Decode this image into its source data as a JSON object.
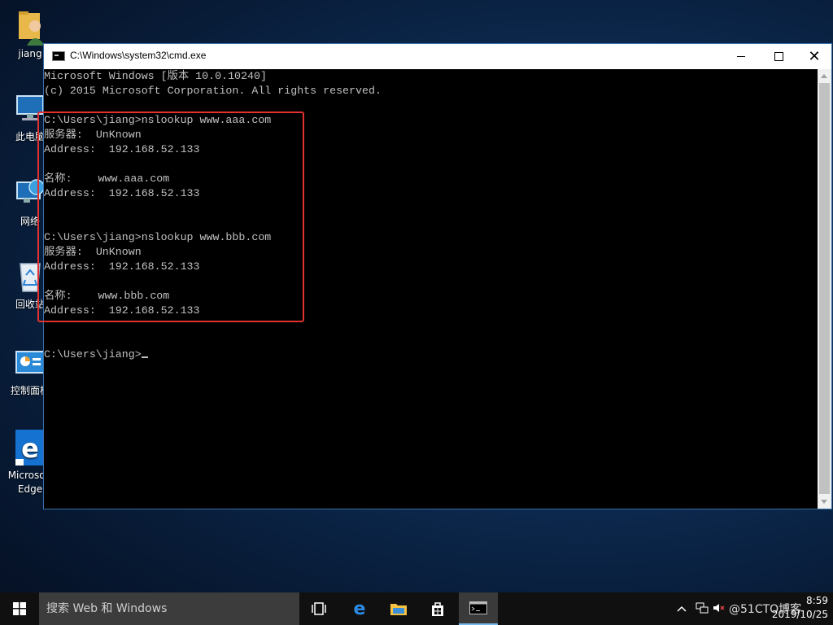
{
  "desktop": {
    "icons": [
      {
        "label": "jiang",
        "icon": "user-folder-icon"
      },
      {
        "label": "此电脑",
        "icon": "this-pc-icon"
      },
      {
        "label": "网络",
        "icon": "network-icon"
      },
      {
        "label": "回收站",
        "icon": "recycle-bin-icon"
      },
      {
        "label": "控制面板",
        "icon": "control-panel-icon"
      },
      {
        "label": "Microsoft",
        "label2": "Edge",
        "icon": "edge-icon"
      }
    ]
  },
  "window": {
    "title": "C:\\Windows\\system32\\cmd.exe",
    "controls": {
      "minimize": "minimize",
      "maximize": "maximize",
      "close": "✕"
    }
  },
  "console": {
    "lines": [
      "Microsoft Windows [版本 10.0.10240]",
      "(c) 2015 Microsoft Corporation. All rights reserved.",
      "",
      "C:\\Users\\jiang>nslookup www.aaa.com",
      "服务器:  UnKnown",
      "Address:  192.168.52.133",
      "",
      "名称:    www.aaa.com",
      "Address:  192.168.52.133",
      "",
      "",
      "C:\\Users\\jiang>nslookup www.bbb.com",
      "服务器:  UnKnown",
      "Address:  192.168.52.133",
      "",
      "名称:    www.bbb.com",
      "Address:  192.168.52.133",
      "",
      "",
      "C:\\Users\\jiang>"
    ]
  },
  "taskbar": {
    "search_placeholder": "搜索 Web 和 Windows",
    "clock_time": "8:59",
    "clock_date": "2019/10/25",
    "watermark": "@51CTO博客"
  },
  "colors": {
    "console_bg": "#000000",
    "console_fg": "#c0c0c0",
    "highlight_border": "#e2312f",
    "taskbar_bg": "#101010"
  }
}
